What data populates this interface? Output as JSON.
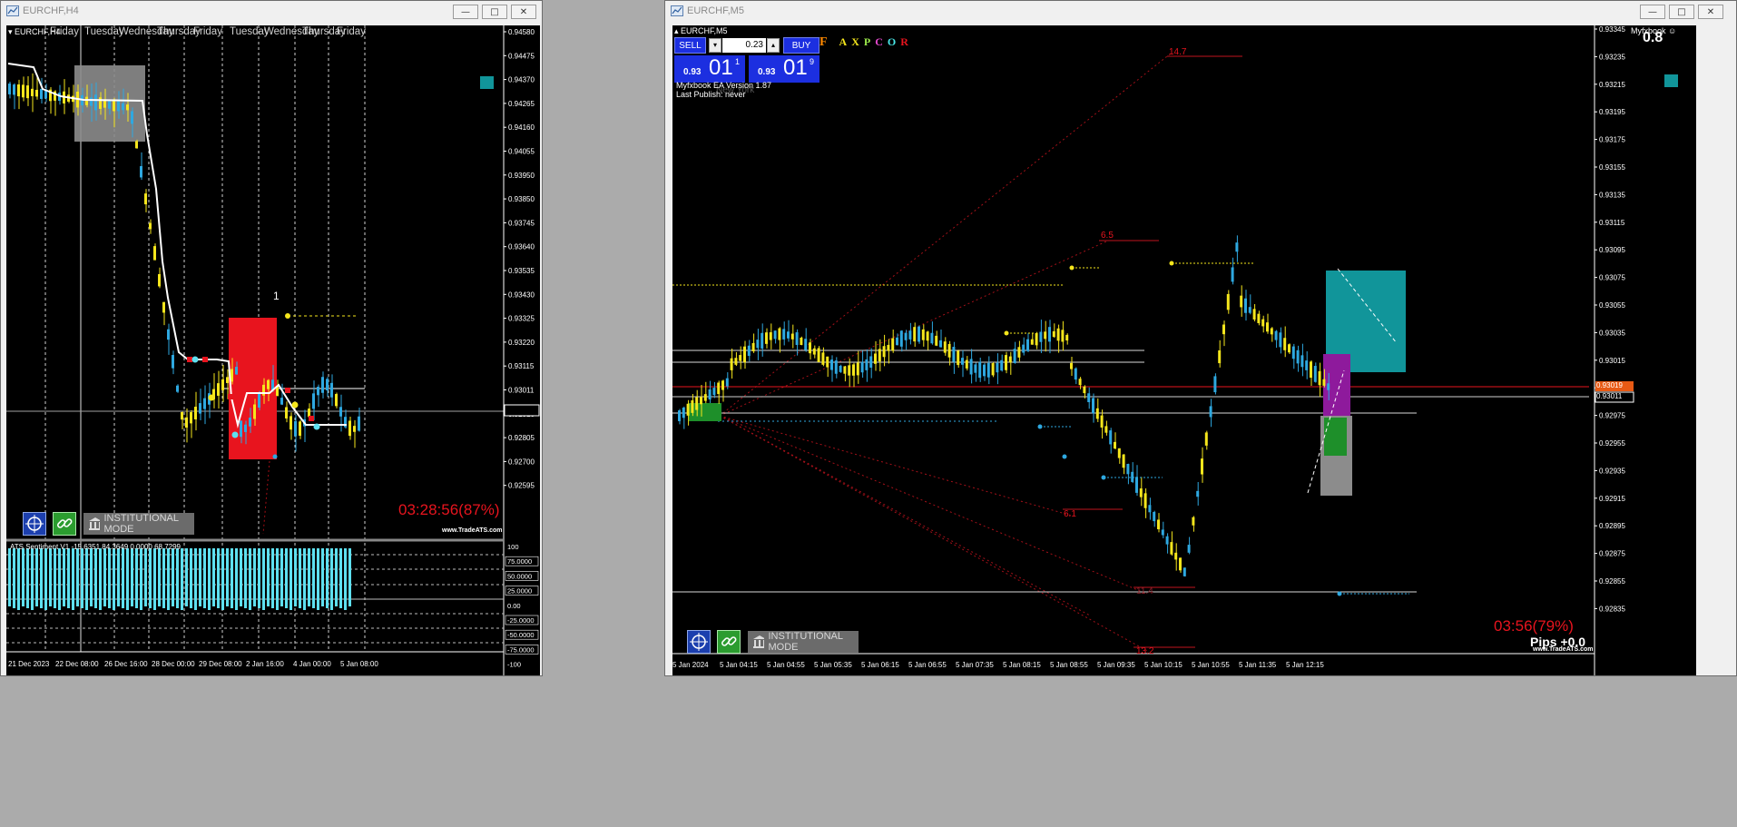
{
  "left_window": {
    "title": "EURCHF,H4",
    "symbol_label": "EURCHF,H4",
    "day_labels": [
      "Friday",
      "Tuesday",
      "Wednesday",
      "Thursday",
      "Friday",
      "Tuesday",
      "Wednesday",
      "Thursday",
      "Friday"
    ],
    "price_ticks": [
      "0.94580",
      "0.94475",
      "0.94370",
      "0.94265",
      "0.94160",
      "0.94055",
      "0.93950",
      "0.93850",
      "0.93745",
      "0.93640",
      "0.93535",
      "0.93430",
      "0.93325",
      "0.93220",
      "0.93115",
      "0.93011",
      "0.92910",
      "0.92805",
      "0.92700",
      "0.92595"
    ],
    "current_price": "0.93011",
    "marker_one": "1",
    "timer": "03:28:56(87%)",
    "watermark": "www.TradeATS.com",
    "institutional_mode": "INSTITUTIONAL MODE",
    "indicator_label": "ATS Sentiment V1 -15.6351 84.3649 0.0000 68.7299",
    "indicator_ticks": [
      "100",
      "75.0000",
      "50.0000",
      "25.0000",
      "0.00",
      "-25.0000",
      "-50.0000",
      "-75.0000",
      "-100"
    ],
    "time_labels": [
      "21 Dec 2023",
      "22 Dec 08:00",
      "26 Dec 16:00",
      "28 Dec 00:00",
      "29 Dec 08:00",
      "2 Jan 16:00",
      "4 Jan 00:00",
      "5 Jan 08:00"
    ]
  },
  "right_window": {
    "title": "EURCHF,M5",
    "symbol_label": "EURCHF,M5",
    "trade_panel": {
      "sell_label": "SELL",
      "buy_label": "BUY",
      "lot_value": "0.23",
      "sell_small": "0.93",
      "sell_big": "01",
      "sell_sup": "1",
      "buy_small": "0.93",
      "buy_big": "01",
      "buy_sup": "9"
    },
    "axpcor_f": "F",
    "axpcor_letters": [
      "A",
      "X",
      "P",
      "C",
      "O",
      "R"
    ],
    "ea_version": "Myfxbook EA Version 1.87",
    "last_publish": "Last Publish: never",
    "new_york": "New York",
    "myfxbook_label": "Myfxbook",
    "top_right_value": "0.8",
    "fib_labels": [
      "14.7",
      "6.5",
      "6.1",
      "11.4",
      "13.2"
    ],
    "price_ticks": [
      "0.93345",
      "0.93235",
      "0.93215",
      "0.93195",
      "0.93175",
      "0.93155",
      "0.93135",
      "0.93115",
      "0.93095",
      "0.93075",
      "0.93055",
      "0.93035",
      "0.93015",
      "0.92995",
      "0.92975",
      "0.92955",
      "0.92935",
      "0.92915",
      "0.92895",
      "0.92875",
      "0.92855",
      "0.92835"
    ],
    "current_price_red": "0.93019",
    "current_price": "0.93011",
    "timer": "03:56(79%)",
    "pips": "Pips +0.0",
    "watermark": "www.TradeATS.com",
    "institutional_mode": "INSTITUTIONAL MODE",
    "time_labels": [
      "5 Jan 2024",
      "5 Jan 04:15",
      "5 Jan 04:55",
      "5 Jan 05:35",
      "5 Jan 06:15",
      "5 Jan 06:55",
      "5 Jan 07:35",
      "5 Jan 08:15",
      "5 Jan 08:55",
      "5 Jan 09:35",
      "5 Jan 10:15",
      "5 Jan 10:55",
      "5 Jan 11:35",
      "5 Jan 12:15"
    ]
  },
  "colors": {
    "bull_candle": "#2ea8e0",
    "bear_candle": "#f5e61c",
    "timer_red": "#e8141e",
    "teal_box": "#11959a",
    "fib_red": "#c0141e"
  }
}
